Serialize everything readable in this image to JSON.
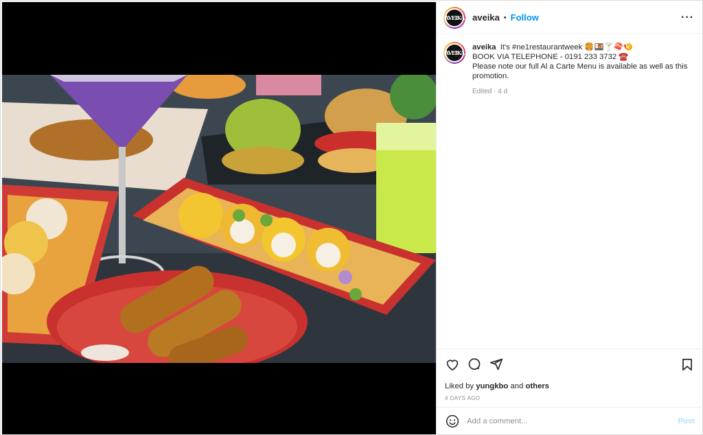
{
  "post": {
    "username": "aveika",
    "follow_label": "Follow",
    "avatar_text": "AVEIKA",
    "caption_line1": "It's #ne1restaurantweek 🍔🍱🍸🍣🍤",
    "caption_line2": "BOOK VIA TELEPHONE - 0191 233 3732 ☎️",
    "caption_line3": "Please note our full Al a Carte Menu is available as well as this promotion.",
    "edited_label": "Edited · 4 d",
    "liked_prefix": "Liked by",
    "liked_user": "yungkbo",
    "liked_and": "and",
    "liked_others": "others",
    "timestamp": "4 DAYS AGO",
    "comment_placeholder": "Add a comment...",
    "post_label": "Post"
  },
  "icons": {
    "more": "more-options-icon",
    "like": "heart-icon",
    "comment": "comment-icon",
    "share": "share-icon",
    "save": "bookmark-icon",
    "emoji": "emoji-icon"
  },
  "colors": {
    "follow": "#0095f6",
    "post_disabled": "#b2dffc",
    "secondary_text": "#8e8e8e"
  }
}
